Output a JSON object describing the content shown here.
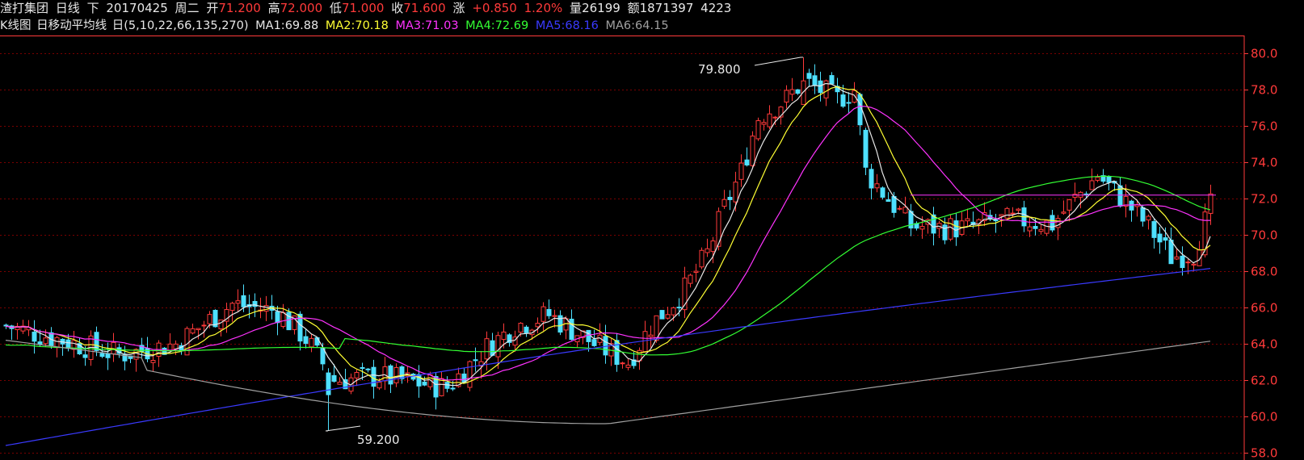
{
  "header": {
    "stock_name": "渣打集团",
    "period": "日线",
    "adjust": "下",
    "date": "20170425",
    "weekday": "周二",
    "open_label": "开",
    "open": "71.200",
    "high_label": "高",
    "high": "72.000",
    "low_label": "低",
    "low": "71.000",
    "close_label": "收",
    "close": "71.600",
    "change_label": "涨",
    "change": "+0.850",
    "change_pct": "1.20%",
    "volume_label": "量",
    "volume": "26199",
    "amount_label": "额",
    "amount": "1871397",
    "extra": "4223"
  },
  "indicator_bar": {
    "prefix": "K线图",
    "ma_title": "日移动平均线",
    "ma_params": "日(5,10,22,66,135,270)",
    "ma": [
      {
        "label": "MA1:",
        "value": "69.88",
        "color": "#e8e8e8"
      },
      {
        "label": "MA2:",
        "value": "70.18",
        "color": "#ffff33"
      },
      {
        "label": "MA3:",
        "value": "71.03",
        "color": "#ff33ff"
      },
      {
        "label": "MA4:",
        "value": "72.69",
        "color": "#33ff33"
      },
      {
        "label": "MA5:",
        "value": "68.16",
        "color": "#3a3aff"
      },
      {
        "label": "MA6:",
        "value": "64.15",
        "color": "#a0a0a0"
      }
    ]
  },
  "colors": {
    "up": "#ff3a3a",
    "down": "#4ee0ff",
    "grid": "#7a0000",
    "axis": "#ff3a3a",
    "ma1": "#e8e8e8",
    "ma2": "#ffff33",
    "ma3": "#ff33ff",
    "ma4": "#33ff33",
    "ma5": "#3a3aff",
    "ma6": "#a0a0a0"
  },
  "chart_data": {
    "type": "candlestick",
    "y_ticks": [
      "58.0",
      "60.0",
      "62.0",
      "64.0",
      "66.0",
      "68.0",
      "70.0",
      "72.0",
      "74.0",
      "76.0",
      "78.0",
      "80.0"
    ],
    "ylim": [
      57.6,
      81.0
    ],
    "grid": "horizontal-dashed",
    "annotations": [
      {
        "text": "79.800",
        "value": 79.8,
        "index": 141
      },
      {
        "text": "59.200",
        "value": 59.2,
        "index": 57
      }
    ],
    "reference_line": {
      "value": 72.2,
      "from_index": 160,
      "to_index": 214
    },
    "candles_summary": {
      "count": 214,
      "anchors": [
        [
          0,
          65.0
        ],
        [
          10,
          64.2
        ],
        [
          20,
          63.4
        ],
        [
          30,
          64.0
        ],
        [
          40,
          66.2
        ],
        [
          48,
          65.8
        ],
        [
          53,
          64.3
        ],
        [
          58,
          62.0
        ],
        [
          66,
          62.2
        ],
        [
          72,
          61.9
        ],
        [
          78,
          61.6
        ],
        [
          85,
          63.8
        ],
        [
          90,
          65.0
        ],
        [
          96,
          65.6
        ],
        [
          104,
          64.0
        ],
        [
          110,
          63.0
        ],
        [
          114,
          65.0
        ],
        [
          120,
          67.0
        ],
        [
          124,
          69.0
        ],
        [
          127,
          71.5
        ],
        [
          130,
          73.5
        ],
        [
          133,
          76.5
        ],
        [
          138,
          77.5
        ],
        [
          141,
          78.5
        ],
        [
          147,
          77.5
        ],
        [
          150,
          78.0
        ],
        [
          152,
          73.5
        ],
        [
          156,
          72.0
        ],
        [
          160,
          70.5
        ],
        [
          165,
          70.4
        ],
        [
          170,
          70.4
        ],
        [
          175,
          70.8
        ],
        [
          180,
          70.8
        ],
        [
          185,
          70.6
        ],
        [
          189,
          72.0
        ],
        [
          193,
          73.3
        ],
        [
          198,
          71.8
        ],
        [
          202,
          70.5
        ],
        [
          206,
          68.8
        ],
        [
          210,
          69.0
        ],
        [
          213,
          71.6
        ]
      ]
    }
  }
}
